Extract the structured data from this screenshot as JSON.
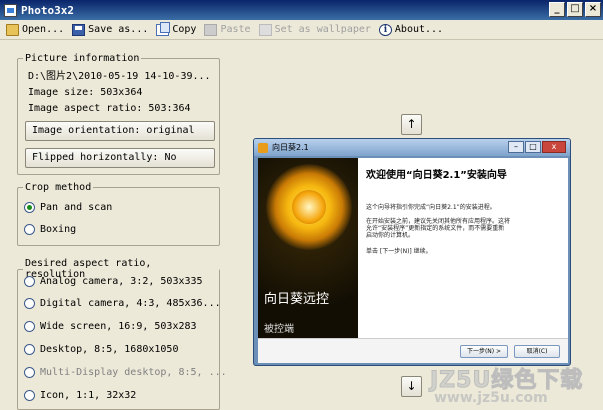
{
  "window": {
    "title": "Photo3x2"
  },
  "toolbar": {
    "open": "Open...",
    "save_as": "Save as...",
    "copy": "Copy",
    "paste": "Paste",
    "set_wallpaper": "Set as wallpaper",
    "about": "About..."
  },
  "picture_info": {
    "legend": "Picture information",
    "path": "D:\\图片2\\2010-05-19 14-10-39...",
    "size": "Image size: 503x364",
    "aspect": "Image aspect ratio: 503:364",
    "orientation_button": "Image orientation: original",
    "flip_button": "Flipped horizontally: No"
  },
  "crop": {
    "legend": "Crop method",
    "options": [
      "Pan and scan",
      "Boxing"
    ],
    "selected": 0
  },
  "desired": {
    "legend": "Desired aspect ratio, resolution",
    "options": [
      "Analog camera, 3:2, 503x335",
      "Digital camera, 4:3, 485x36...",
      "Wide screen, 16:9, 503x283",
      "Desktop, 8:5, 1680x1050",
      "Multi-Display desktop, 8:5, ...",
      "Icon, 1:1, 32x32"
    ]
  },
  "nav": {
    "up": "↑",
    "down": "↓"
  },
  "preview": {
    "title": "向日葵2.1",
    "brand": "向日葵远控",
    "sub": "被控端",
    "heading": "欢迎使用“向日葵2.1”安装向导",
    "p1": "这个向导将指引你完成“向日葵2.1”的安装进程。",
    "p2a": "在开始安装之前，建议先关闭其他所有应用程序。这将",
    "p2b": "允许“安装程序”更新指定的系统文件，而不需要重新",
    "p2c": "启动你的计算机。",
    "p3": "单击 [下一步(N)] 继续。",
    "next": "下一步(N) >",
    "cancel": "取消(C)"
  },
  "watermark": {
    "top": "JZ5U绿色下载",
    "bottom": "www.jz5u.com"
  }
}
